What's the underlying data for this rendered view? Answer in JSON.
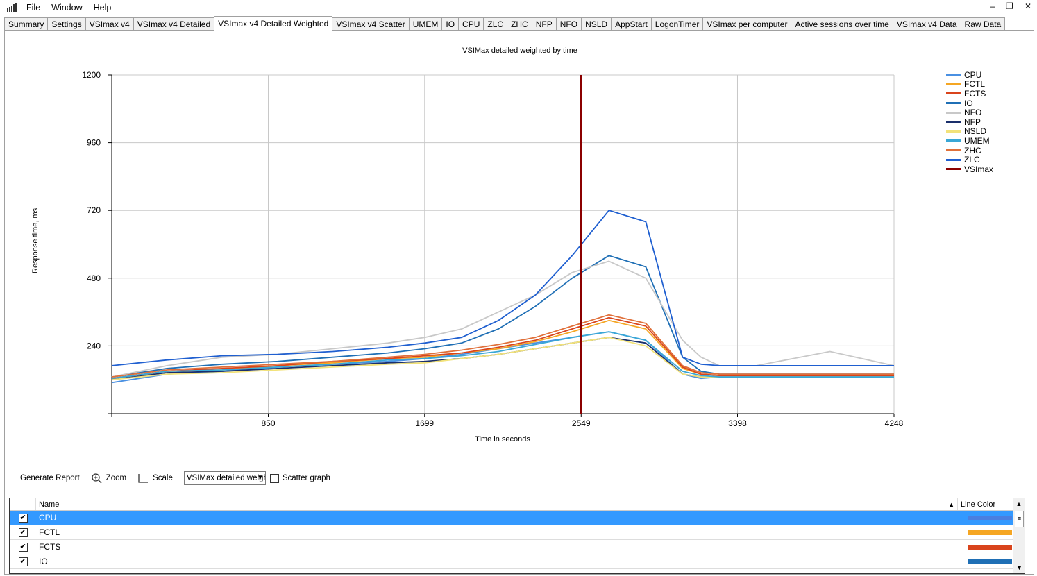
{
  "menu": {
    "file": "File",
    "window": "Window",
    "help": "Help"
  },
  "window_controls": {
    "minimize": "–",
    "restore": "❐",
    "close": "✕"
  },
  "tabs": [
    "Summary",
    "Settings",
    "VSImax v4",
    "VSImax v4 Detailed",
    "VSImax v4 Detailed Weighted",
    "VSImax v4 Scatter",
    "UMEM",
    "IO",
    "CPU",
    "ZLC",
    "ZHC",
    "NFP",
    "NFO",
    "NSLD",
    "AppStart",
    "LogonTimer",
    "VSImax per computer",
    "Active sessions over time",
    "VSImax v4 Data",
    "Raw Data"
  ],
  "active_tab": 4,
  "chart_data": {
    "type": "line",
    "title": "VSIMax detailed weighted by time",
    "xlabel": "Time in seconds",
    "ylabel": "Response time, ms",
    "xlim": [
      0,
      4248
    ],
    "ylim": [
      0,
      1200
    ],
    "x_ticks": [
      850,
      1699,
      2549,
      3398,
      4248
    ],
    "y_ticks": [
      240,
      480,
      720,
      960,
      1200
    ],
    "grid": true,
    "legend_position": "right",
    "vsimax_x": 2549,
    "series": [
      {
        "name": "CPU",
        "color": "#4a90e2",
        "x": [
          0,
          300,
          600,
          900,
          1200,
          1500,
          1700,
          1900,
          2100,
          2300,
          2500,
          2700,
          2900,
          3100,
          3200,
          3300,
          3500,
          4248
        ],
        "y": [
          110,
          140,
          150,
          165,
          175,
          185,
          195,
          210,
          230,
          250,
          270,
          290,
          260,
          140,
          125,
          130,
          130,
          130
        ]
      },
      {
        "name": "FCTL",
        "color": "#f5a623",
        "x": [
          0,
          300,
          600,
          900,
          1200,
          1500,
          1700,
          1900,
          2100,
          2300,
          2500,
          2700,
          2900,
          3100,
          3200,
          3300,
          3500,
          4248
        ],
        "y": [
          125,
          150,
          155,
          170,
          180,
          195,
          200,
          215,
          230,
          255,
          290,
          330,
          300,
          160,
          140,
          135,
          135,
          135
        ]
      },
      {
        "name": "FCTS",
        "color": "#d9441c",
        "x": [
          0,
          300,
          600,
          900,
          1200,
          1500,
          1700,
          1900,
          2100,
          2300,
          2500,
          2700,
          2900,
          3100,
          3200,
          3300,
          3500,
          4248
        ],
        "y": [
          125,
          150,
          160,
          170,
          185,
          195,
          205,
          215,
          235,
          260,
          300,
          340,
          310,
          165,
          140,
          135,
          135,
          135
        ]
      },
      {
        "name": "IO",
        "color": "#1f6fb5",
        "x": [
          0,
          300,
          600,
          900,
          1200,
          1500,
          1700,
          1900,
          2100,
          2300,
          2500,
          2700,
          2900,
          3100,
          3200,
          3300,
          3500,
          4248
        ],
        "y": [
          130,
          160,
          175,
          185,
          200,
          215,
          230,
          250,
          300,
          380,
          480,
          560,
          520,
          200,
          150,
          140,
          140,
          140
        ]
      },
      {
        "name": "NFO",
        "color": "#c8c8c8",
        "x": [
          0,
          300,
          600,
          900,
          1200,
          1500,
          1700,
          1900,
          2100,
          2300,
          2500,
          2700,
          2900,
          3100,
          3200,
          3300,
          3500,
          3900,
          4248
        ],
        "y": [
          130,
          170,
          200,
          210,
          230,
          250,
          270,
          300,
          360,
          420,
          500,
          540,
          480,
          260,
          200,
          170,
          170,
          220,
          170
        ]
      },
      {
        "name": "NFP",
        "color": "#1a2f6b",
        "x": [
          0,
          300,
          600,
          900,
          1200,
          1500,
          1700,
          1900,
          2100,
          2300,
          2500,
          2700,
          2900,
          3100,
          3200,
          3300,
          3500,
          4248
        ],
        "y": [
          120,
          145,
          150,
          160,
          170,
          180,
          185,
          195,
          210,
          230,
          250,
          270,
          250,
          140,
          130,
          130,
          130,
          130
        ]
      },
      {
        "name": "NSLD",
        "color": "#f2e27a",
        "x": [
          0,
          300,
          600,
          900,
          1200,
          1500,
          1700,
          1900,
          2100,
          2300,
          2500,
          2700,
          2900,
          3100,
          3200,
          3300,
          3500,
          4248
        ],
        "y": [
          120,
          140,
          145,
          155,
          165,
          175,
          180,
          195,
          210,
          230,
          250,
          270,
          240,
          140,
          130,
          130,
          130,
          130
        ]
      },
      {
        "name": "UMEM",
        "color": "#39a7d6",
        "x": [
          0,
          300,
          600,
          900,
          1200,
          1500,
          1700,
          1900,
          2100,
          2300,
          2500,
          2700,
          2900,
          3100,
          3200,
          3300,
          3500,
          4248
        ],
        "y": [
          125,
          150,
          155,
          165,
          175,
          190,
          195,
          205,
          220,
          245,
          270,
          290,
          260,
          150,
          135,
          130,
          130,
          130
        ]
      },
      {
        "name": "ZHC",
        "color": "#e0703a",
        "x": [
          0,
          300,
          600,
          900,
          1200,
          1500,
          1700,
          1900,
          2100,
          2300,
          2500,
          2700,
          2900,
          3100,
          3200,
          3300,
          3500,
          4248
        ],
        "y": [
          130,
          155,
          165,
          175,
          185,
          200,
          210,
          225,
          245,
          270,
          310,
          350,
          320,
          170,
          145,
          140,
          140,
          140
        ]
      },
      {
        "name": "ZLC",
        "color": "#1f5fd0",
        "x": [
          0,
          300,
          600,
          900,
          1200,
          1500,
          1700,
          1900,
          2100,
          2300,
          2500,
          2700,
          2900,
          3100,
          3200,
          3300,
          3500,
          4248
        ],
        "y": [
          170,
          190,
          205,
          210,
          220,
          235,
          250,
          270,
          330,
          420,
          560,
          720,
          680,
          200,
          175,
          170,
          170,
          170
        ]
      },
      {
        "name": "VSImax",
        "color": "#8b0000",
        "x": [
          2549,
          2549
        ],
        "y": [
          0,
          1200
        ]
      }
    ]
  },
  "toolbar": {
    "generate_report": "Generate Report",
    "zoom": "Zoom",
    "scale": "Scale",
    "selected_chart": "VSIMax detailed weighted by time",
    "scatter_graph": "Scatter graph"
  },
  "grid": {
    "col_name": "Name",
    "col_color": "Line Color",
    "rows": [
      {
        "name": "CPU",
        "checked": "✔",
        "color": "#4a7fe0",
        "selected": true
      },
      {
        "name": "FCTL",
        "checked": "✔",
        "color": "#f5a623"
      },
      {
        "name": "FCTS",
        "checked": "✔",
        "color": "#d9441c"
      },
      {
        "name": "IO",
        "checked": "✔",
        "color": "#1f6fb5"
      }
    ]
  }
}
